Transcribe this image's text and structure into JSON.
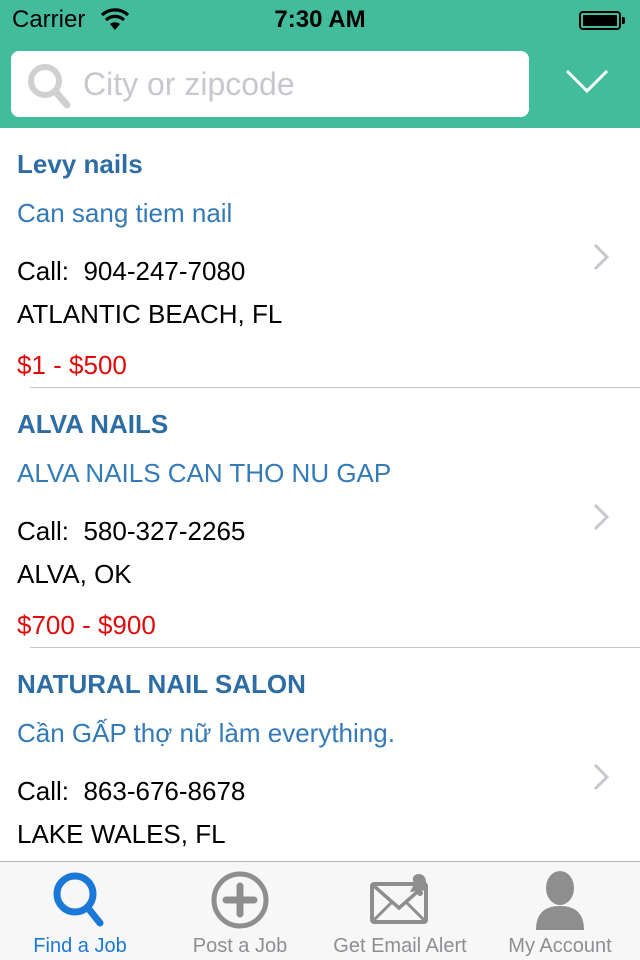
{
  "status_bar": {
    "carrier": "Carrier",
    "time": "7:30 AM"
  },
  "search": {
    "placeholder": "City or zipcode",
    "value": ""
  },
  "colors": {
    "header": "#43bc9b",
    "name": "#2e6da4",
    "title": "#337ab7",
    "salary": "#e00a0a",
    "tab_active": "#1a78d6",
    "tab_inactive": "#8e8e93"
  },
  "jobs": [
    {
      "name": "Levy nails",
      "title": "Can sang tiem nail",
      "phone": "Call:  904-247-7080",
      "location": "ATLANTIC BEACH, FL",
      "salary": "$1 - $500"
    },
    {
      "name": "ALVA NAILS",
      "title": "ALVA NAILS CAN THO NU GAP",
      "phone": "Call:  580-327-2265",
      "location": "ALVA, OK",
      "salary": "$700 - $900"
    },
    {
      "name": "NATURAL NAIL SALON",
      "title": "Cần GẤP thợ nữ làm everything.",
      "phone": "Call:  863-676-8678",
      "location": "LAKE WALES, FL",
      "salary": ""
    }
  ],
  "tabbar": {
    "tabs": [
      {
        "label": "Find a Job",
        "icon": "search-icon",
        "active": true
      },
      {
        "label": "Post a Job",
        "icon": "plus-circle-icon",
        "active": false
      },
      {
        "label": "Get Email Alert",
        "icon": "mail-bell-icon",
        "active": false
      },
      {
        "label": "My Account",
        "icon": "person-icon",
        "active": false
      }
    ]
  }
}
